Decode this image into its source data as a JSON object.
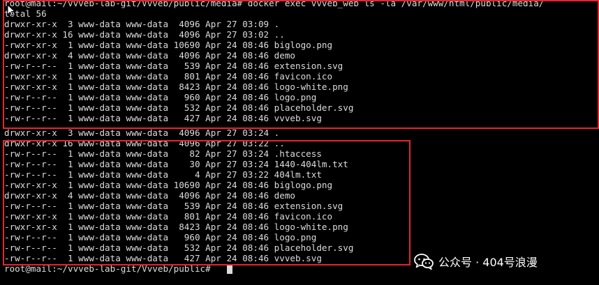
{
  "terminal": {
    "colors": {
      "background": "#000000",
      "foreground": "#dcdcdc",
      "highlight_box": "#e8242e"
    },
    "lines": [
      "root@mail:~/vvveb-lab-git/Vvveb/public/media# docker exec vvveb_web ls -la /var/www/html/public/media/",
      "total 56",
      "drwxr-xr-x  3 www-data www-data  4096 Apr 27 03:09 .",
      "drwxr-xr-x 16 www-data www-data  4096 Apr 27 03:02 ..",
      "-rwxr-xr-x  1 www-data www-data 10690 Apr 24 08:46 biglogo.png",
      "drwxr-xr-x  4 www-data www-data  4096 Apr 24 08:46 demo",
      "-rw-r--r--  1 www-data www-data   539 Apr 24 08:46 extension.svg",
      "-rwxr-xr-x  1 www-data www-data   801 Apr 24 08:46 favicon.ico",
      "-rwxr-xr-x  1 www-data www-data  8423 Apr 24 08:46 logo-white.png",
      "-rw-r--r--  1 www-data www-data   960 Apr 24 08:46 logo.png",
      "-rw-r--r--  1 www-data www-data   532 Apr 24 08:46 placeholder.svg",
      "-rw-r--r--  1 www-data www-data   427 Apr 24 08:46 vvveb.svg",
      "drwxr-xr-x  3 www-data www-data  4096 Apr 27 03:24 .",
      "drwxr-xr-x 16 www-data www-data  4096 Apr 27 03:22 ..",
      "-rw-r--r--  1 www-data www-data    82 Apr 27 03:24 .htaccess",
      "-rw-r--r--  1 www-data www-data    30 Apr 27 03:24 1440-404lm.txt",
      "-rw-r--r--  1 www-data www-data     4 Apr 27 03:22 404lm.txt",
      "-rwxr-xr-x  1 www-data www-data 10690 Apr 24 08:46 biglogo.png",
      "drwxr-xr-x  4 www-data www-data  4096 Apr 24 08:46 demo",
      "-rw-r--r--  1 www-data www-data   539 Apr 24 08:46 extension.svg",
      "-rwxr-xr-x  1 www-data www-data   801 Apr 24 08:46 favicon.ico",
      "-rwxr-xr-x  1 www-data www-data  8423 Apr 24 08:46 logo-white.png",
      "-rw-r--r--  1 www-data www-data   960 Apr 24 08:46 logo.png",
      "-rw-r--r--  1 www-data www-data   532 Apr 24 08:46 placeholder.svg",
      "-rw-r--r--  1 www-data www-data   427 Apr 24 08:46 vvveb.svg",
      "root@mail:~/vvveb-lab-git/Vvveb/public#"
    ]
  },
  "watermark": {
    "text": "公众号 · 404号浪漫",
    "icon": "wechat-icon",
    "color": "#ffffff"
  }
}
